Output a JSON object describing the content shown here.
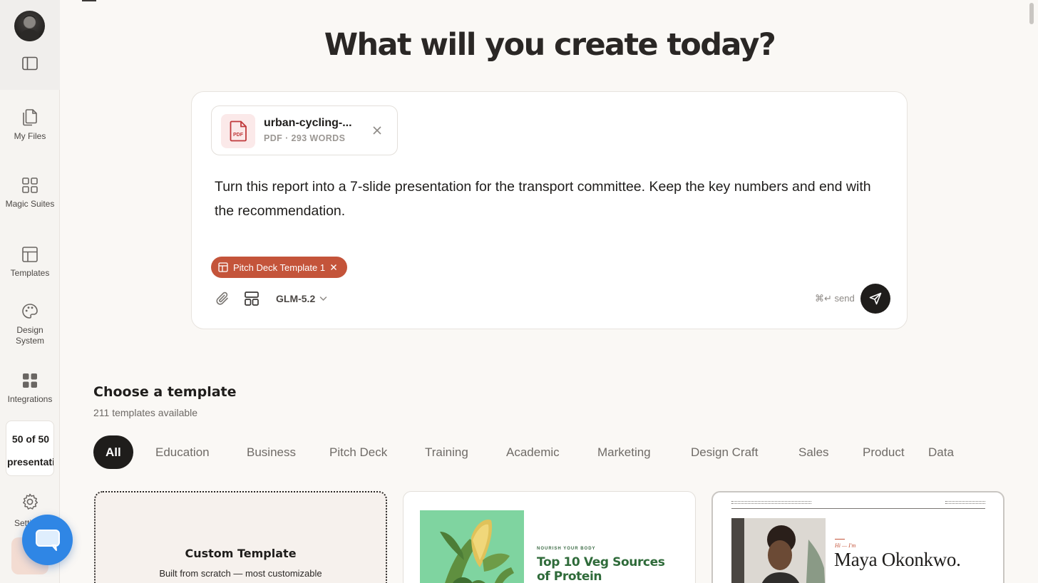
{
  "sidebar": {
    "items": [
      {
        "label": "My Files",
        "icon": "files-icon"
      },
      {
        "label": "Magic Suites",
        "icon": "grid-icon"
      },
      {
        "label": "Templates",
        "icon": "layout-icon"
      },
      {
        "label": "Design System",
        "icon": "palette-icon"
      },
      {
        "label": "Integrations",
        "icon": "apps-icon"
      }
    ],
    "usage": {
      "count": "50 of 50",
      "unit": "presentatio"
    },
    "settings_label": "Setti"
  },
  "hero": {
    "title": "What will you create today?"
  },
  "composer": {
    "attachment": {
      "name": "urban-cycling-...",
      "meta": "PDF · 293 WORDS",
      "icon_text": "PDF"
    },
    "prompt": "Turn this report into a 7-slide presentation for the transport committee. Keep the key numbers and end with the recommendation.",
    "template_chip": "Pitch Deck Template 1",
    "model": "GLM-5.2",
    "send_hint": "⌘↵ send"
  },
  "templates": {
    "title": "Choose a template",
    "count_text": "211 templates available",
    "filters": [
      {
        "label": "All",
        "active": true
      },
      {
        "label": "Education"
      },
      {
        "label": "Business"
      },
      {
        "label": "Pitch Deck"
      },
      {
        "label": "Training"
      },
      {
        "label": "Academic"
      },
      {
        "label": "Marketing"
      },
      {
        "label": "Design Craft"
      },
      {
        "label": "Sales"
      },
      {
        "label": "Product"
      },
      {
        "label": "Data"
      }
    ],
    "cards": [
      {
        "title": "Custom Template",
        "subtitle": "Built from scratch — most customizable"
      },
      {
        "kicker": "NOURISH YOUR BODY",
        "title": "Top 10 Veg Sources of Protein"
      },
      {
        "greeting": "Hi — I'm",
        "title": "Maya Okonkwo."
      }
    ]
  },
  "colors": {
    "background": "#faf8f5",
    "accent": "#c4543a",
    "dark": "#1f1d1b",
    "chat_fab": "#2f86e5"
  }
}
